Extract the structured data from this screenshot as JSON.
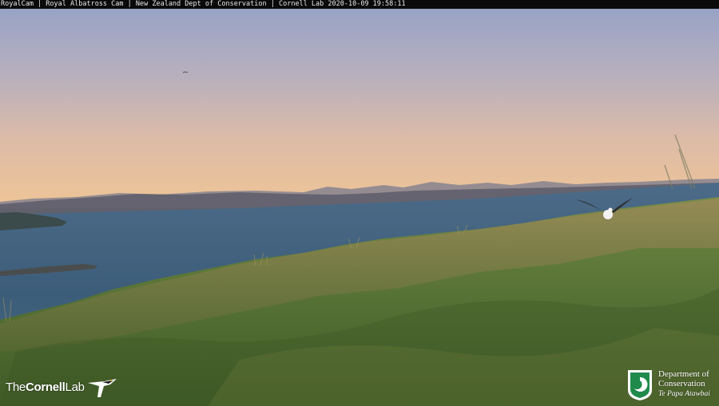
{
  "overlay": {
    "caption": "RoyalCam | Royal Albatross Cam | New Zealand Dept of Conservation | Cornell Lab 2020-10-09 19:58:11"
  },
  "logos": {
    "cornell": {
      "part1": "The",
      "part2": "Cornell",
      "part3": "Lab"
    },
    "doc": {
      "line1": "Department of",
      "line2": "Conservation",
      "line3": "Te Papa Atawbai"
    }
  },
  "colors": {
    "sky_top": "#9aa6c8",
    "sky_horizon": "#f0c79a",
    "sea": "#3d5f7a",
    "grass": "#5e7a3c",
    "doc_green": "#1f8a4c"
  }
}
